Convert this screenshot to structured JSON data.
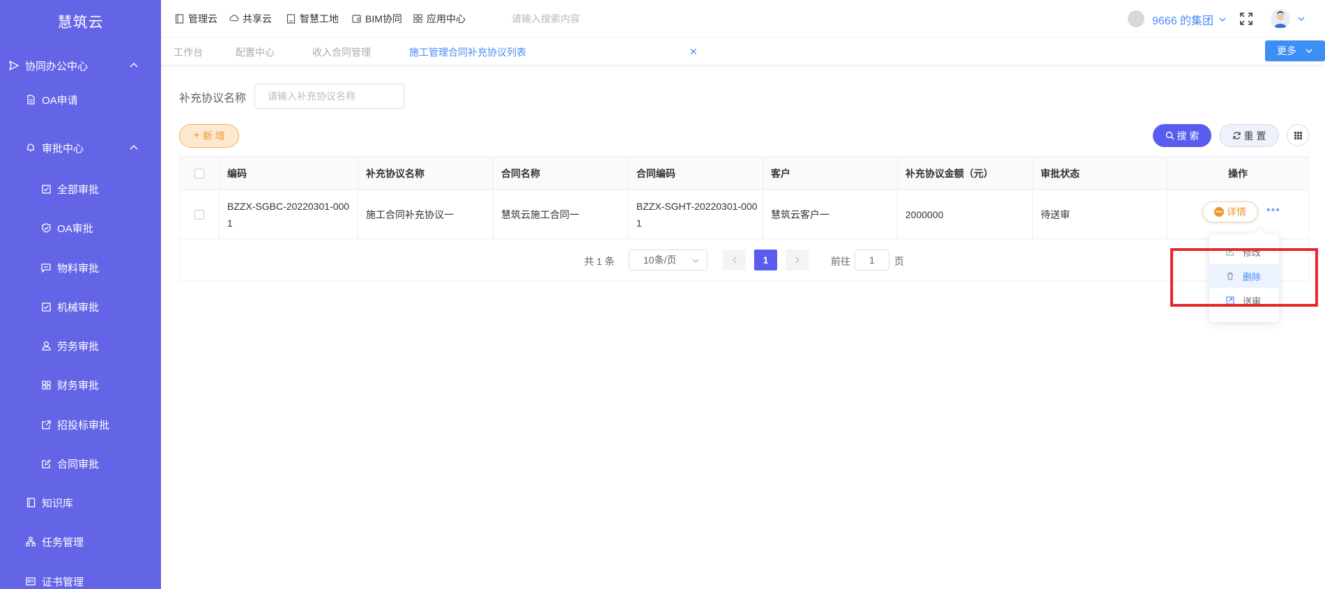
{
  "sidebar": {
    "brand": "慧筑云",
    "items": [
      {
        "label": "协同办公中心",
        "icon": "send-icon"
      },
      {
        "label": "OA申请",
        "icon": "document-icon"
      },
      {
        "label": "审批中心",
        "icon": "bell-icon"
      },
      {
        "label": "全部审批",
        "icon": "checkbox-icon"
      },
      {
        "label": "OA审批",
        "icon": "shield-check-icon"
      },
      {
        "label": "物料审批",
        "icon": "comment-icon"
      },
      {
        "label": "机械审批",
        "icon": "checkbox-icon"
      },
      {
        "label": "劳务审批",
        "icon": "user-icon"
      },
      {
        "label": "财务审批",
        "icon": "grid-icon"
      },
      {
        "label": "招投标审批",
        "icon": "external-link-icon"
      },
      {
        "label": "合同审批",
        "icon": "edit-icon"
      },
      {
        "label": "知识库",
        "icon": "book-icon"
      },
      {
        "label": "任务管理",
        "icon": "org-chart-icon"
      },
      {
        "label": "证书管理",
        "icon": "certificate-icon"
      }
    ]
  },
  "topbar": {
    "links": [
      {
        "label": "管理云",
        "icon": "panel-icon"
      },
      {
        "label": "共享云",
        "icon": "cloud-icon"
      },
      {
        "label": "智慧工地",
        "icon": "monitor-icon"
      },
      {
        "label": "BIM协同",
        "icon": "wallet-icon"
      },
      {
        "label": "应用中心",
        "icon": "apps-icon"
      }
    ],
    "search_placeholder": "请输入搜索内容",
    "group_name": "9666 的集团"
  },
  "tabs": [
    {
      "label": "工作台"
    },
    {
      "label": "配置中心"
    },
    {
      "label": "收入合同管理"
    },
    {
      "label": "施工管理合同补充协议列表"
    }
  ],
  "more_label": "更多",
  "filter": {
    "label": "补充协议名称",
    "placeholder": "请输入补充协议名称",
    "value": ""
  },
  "toolbar": {
    "add_label": "新 增",
    "search_label": "搜 索",
    "reset_label": "重 置"
  },
  "table": {
    "columns": [
      "编码",
      "补充协议名称",
      "合同名称",
      "合同编码",
      "客户",
      "补充协议金额（元）",
      "审批状态",
      "操作"
    ],
    "rows": [
      {
        "code": "BZZX-SGBC-20220301-0001",
        "name": "施工合同补充协议一",
        "contract_name": "慧筑云施工合同一",
        "contract_code": "BZZX-SGHT-20220301-0001",
        "customer": "慧筑云客户一",
        "amount": "2000000",
        "status": "待送审",
        "detail_label": "详情"
      }
    ]
  },
  "pagination": {
    "total": "共 1 条",
    "page_size": "10条/页",
    "current": "1",
    "goto_label": "前往",
    "goto_value": "1",
    "page_suffix": "页"
  },
  "dropdown": {
    "items": [
      {
        "label": "修改",
        "icon": "edit-icon"
      },
      {
        "label": "删除",
        "icon": "trash-icon"
      },
      {
        "label": "送审",
        "icon": "send-review-icon"
      }
    ]
  },
  "colors": {
    "sidebar_bg": "#6464e6",
    "primary": "#5a5cf0",
    "link_blue": "#4a8cf6",
    "add_orange": "#f0962d",
    "highlight_red": "#e8262d"
  }
}
